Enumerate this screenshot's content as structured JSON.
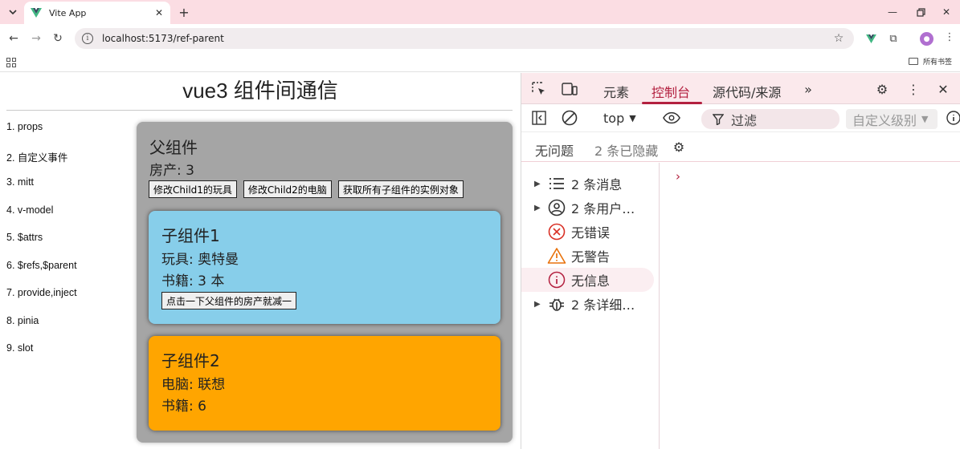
{
  "browser": {
    "tab": {
      "title": "Vite App"
    },
    "url": "localhost:5173/ref-parent",
    "bookmarks": {
      "folder_label": "所有书签"
    },
    "colors": {
      "tabstrip": "#fbdde3",
      "vue_green": "#41b883"
    }
  },
  "page": {
    "title": "vue3 组件间通信",
    "nav": [
      "1. props",
      "2. 自定义事件",
      "3. mitt",
      "4. v-model",
      "5. $attrs",
      "6. $refs,$parent",
      "7. provide,inject",
      "8. pinia",
      "9. slot"
    ],
    "parent": {
      "title": "父组件",
      "house": "房产: 3",
      "buttons": [
        "修改Child1的玩具",
        "修改Child2的电脑",
        "获取所有子组件的实例对象"
      ],
      "color": "#a5a5a5"
    },
    "child1": {
      "title": "子组件1",
      "toy": "玩具: 奥特曼",
      "books": "书籍: 3 本",
      "button": "点击一下父组件的房产就减一",
      "color": "#87ceea"
    },
    "child2": {
      "title": "子组件2",
      "computer": "电脑: 联想",
      "books": "书籍: 6",
      "color": "#ffa500"
    }
  },
  "devtools": {
    "tabs": [
      "元素",
      "控制台",
      "源代码/来源"
    ],
    "active_tab": "控制台",
    "context": "top",
    "filter_placeholder": "过滤",
    "levels": "自定义级别",
    "issues": {
      "none": "无问题",
      "hidden": "2 条已隐藏"
    },
    "sidebar": [
      {
        "label": "2 条消息",
        "icon": "list-icon",
        "expandable": true
      },
      {
        "label": "2 条用户…",
        "icon": "user-icon",
        "expandable": true
      },
      {
        "label": "无错误",
        "icon": "error-icon",
        "expandable": false
      },
      {
        "label": "无警告",
        "icon": "warning-icon",
        "expandable": false
      },
      {
        "label": "无信息",
        "icon": "info-icon",
        "expandable": false,
        "selected": true
      },
      {
        "label": "2 条详细…",
        "icon": "bug-icon",
        "expandable": true
      }
    ],
    "prompt": "›",
    "colors": {
      "accent": "#b3203f",
      "error": "#d93025",
      "warning": "#e8710a"
    }
  }
}
